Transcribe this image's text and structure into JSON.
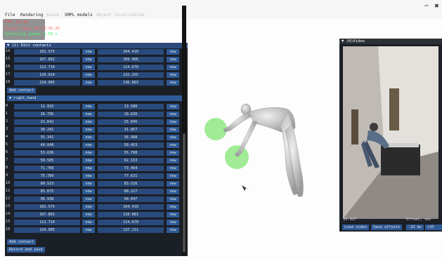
{
  "window": {
    "minimize_glyph": "⌐",
    "close_glyph": "✖"
  },
  "menu": {
    "items": [
      "File",
      "Rendering",
      "Scene",
      "SMPL models",
      "Object localization"
    ],
    "disabled": [
      false,
      false,
      true,
      false,
      true
    ]
  },
  "overlay": {
    "fps": "FPS: 62.44",
    "global_time": "Global time: 00:32:35.22",
    "scrolling_speed": "Scrolling speed: 0.60 x",
    "fps_color": "#ff4040",
    "time_color": "#ff5050",
    "speed_color": "#30ff60"
  },
  "contacts_panel": {
    "title": "▼ (1) Edit contacts",
    "close_glyph": "✕",
    "now_label": "now",
    "left_hand_rows": [
      {
        "index": "14",
        "a": "102.575",
        "b": "104.410"
      },
      {
        "index": "15",
        "a": "107.892",
        "b": "109.966"
      },
      {
        "index": "16",
        "a": "112.710",
        "b": "114.670"
      },
      {
        "index": "17",
        "a": "129.914",
        "b": "132.255"
      },
      {
        "index": "18",
        "a": "134.905",
        "b": "136.893"
      }
    ],
    "add_contact_label": "Add contact",
    "right_hand_header": "▼ right_hand",
    "right_hand_rows": [
      {
        "index": "0",
        "a": "11.932",
        "b": "13.580"
      },
      {
        "index": "1",
        "a": "16.795",
        "b": "18.620"
      },
      {
        "index": "2",
        "a": "21.642",
        "b": "25.045"
      },
      {
        "index": "3",
        "a": "30.281",
        "b": "31.857"
      },
      {
        "index": "4",
        "a": "35.341",
        "b": "36.998"
      },
      {
        "index": "5",
        "a": "48.048",
        "b": "50.453"
      },
      {
        "index": "6",
        "a": "53.636",
        "b": "55.708"
      },
      {
        "index": "7",
        "a": "58.585",
        "b": "62.153"
      },
      {
        "index": "8",
        "a": "71.708",
        "b": "73.464"
      },
      {
        "index": "9",
        "a": "75.789",
        "b": "77.621"
      },
      {
        "index": "10",
        "a": "80.523",
        "b": "83.516"
      },
      {
        "index": "11",
        "a": "85.675",
        "b": "88.217"
      },
      {
        "index": "12",
        "a": "96.938",
        "b": "99.047"
      },
      {
        "index": "13",
        "a": "102.575",
        "b": "104.410"
      },
      {
        "index": "14",
        "a": "107.892",
        "b": "110.081"
      },
      {
        "index": "15",
        "a": "112.710",
        "b": "114.670"
      },
      {
        "index": "16",
        "a": "134.905",
        "b": "137.111"
      }
    ],
    "add_contact_label_2": "Add contact",
    "record_save_label": "Record and save"
  },
  "video_panel": {
    "title": "▼ (0)Video",
    "time_value": "35.927",
    "offset_label": "Offset, sec",
    "load_video": "Load video",
    "save_offsets": "Save offsets",
    "minus_btn": "-33 ms",
    "plus_btn": "+33 ms"
  },
  "colors": {
    "contact_sphere": "#55dd44",
    "body": "#c8c8c8",
    "panel_bg": "#1b1f26",
    "panel_header": "#2d4a7a",
    "field_bg": "#294a7c",
    "button_bg": "#2f5a96"
  }
}
